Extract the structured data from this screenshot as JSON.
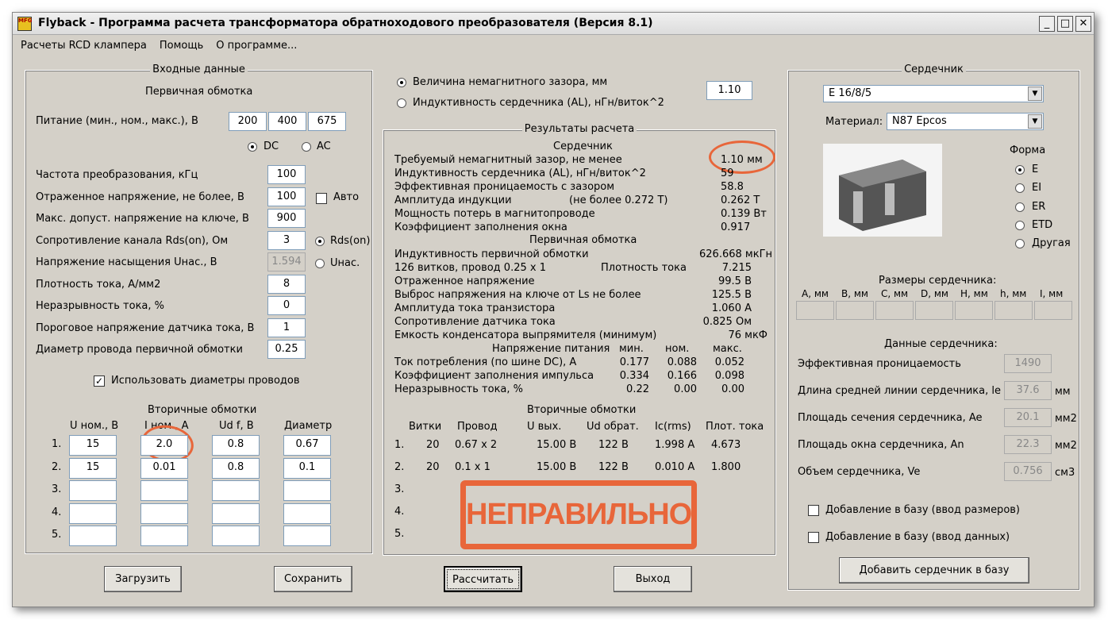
{
  "window": {
    "title": "Flyback - Программа расчета трансформатора обратноходового преобразователя (Версия 8.1)",
    "app_icon_text": "MFG"
  },
  "menu": [
    "Расчеты RCD клампера",
    "Помощь",
    "О программе..."
  ],
  "input": {
    "group": "Входные данные",
    "primary": "Первичная обмотка",
    "supply_label": "Питание (мин., ном., макс.), В",
    "supply": [
      "200",
      "400",
      "675"
    ],
    "dc": "DC",
    "ac": "AC",
    "dc_selected": true,
    "rows": [
      {
        "label": "Частота преобразования, кГц",
        "value": "100"
      },
      {
        "label": "Отраженное напряжение, не более, В",
        "value": "100"
      },
      {
        "label": "Макс. допуст. напряжение на ключе, В",
        "value": "900"
      },
      {
        "label": "Сопротивление канала Rds(on), Ом",
        "value": "3"
      },
      {
        "label": "Напряжение насыщения Uнас., В",
        "value": "1.594"
      },
      {
        "label": "Плотность тока, А/мм2",
        "value": "8"
      },
      {
        "label": "Неразрывность тока, %",
        "value": "0"
      },
      {
        "label": "Пороговое напряжение датчика тока, В",
        "value": "1"
      },
      {
        "label": "Диаметр провода первичной обмотки",
        "value": "0.25"
      }
    ],
    "auto": "Авто",
    "auto_checked": false,
    "rds": "Rds(on)",
    "usat": "Uнас.",
    "rds_selected": true,
    "use_diam": "Использовать диаметры проводов",
    "use_diam_checked": true,
    "secondary": "Вторичные обмотки",
    "sec_headers": [
      "U ном., В",
      "I ном., А",
      "Ud f, В",
      "Диаметр"
    ],
    "sec_rows": [
      {
        "n": "1.",
        "v": [
          "15",
          "2.0",
          "0.8",
          "0.67"
        ]
      },
      {
        "n": "2.",
        "v": [
          "15",
          "0.01",
          "0.8",
          "0.1"
        ]
      },
      {
        "n": "3.",
        "v": [
          "",
          "",
          "",
          ""
        ]
      },
      {
        "n": "4.",
        "v": [
          "",
          "",
          "",
          ""
        ]
      },
      {
        "n": "5.",
        "v": [
          "",
          "",
          "",
          ""
        ]
      }
    ]
  },
  "gap": {
    "opt1": "Величина немагнитного зазора, мм",
    "opt2": "Индуктивность сердечника (AL), нГн/виток^2",
    "value": "1.10",
    "opt1_selected": true
  },
  "results": {
    "group": "Результаты расчета",
    "core": "Сердечник",
    "core_rows": [
      [
        "Требуемый немагнитный зазор, не менее",
        "",
        "1.10 мм"
      ],
      [
        "Индуктивность сердечника (AL), нГн/виток^2",
        "",
        "59"
      ],
      [
        "Эффективная проницаемость с зазором",
        "",
        "58.8"
      ],
      [
        "Амплитуда индукции",
        "(не более 0.272 Т)",
        "0.262 Т"
      ],
      [
        "Мощность потерь в магнитопроводе",
        "",
        "0.139 Вт"
      ],
      [
        "Коэффициент заполнения окна",
        "",
        "0.917"
      ]
    ],
    "primary": "Первичная обмотка",
    "prim_rows": [
      [
        "Индуктивность первичной обмотки",
        "",
        "626.668 мкГн"
      ],
      [
        "126  витков, провод 0.25 x 1",
        "Плотность тока",
        "7.215"
      ],
      [
        "Отраженное напряжение",
        "",
        "99.5 В"
      ],
      [
        "Выброс напряжения на ключе от Ls не более",
        "",
        "125.5 В"
      ],
      [
        "Амплитуда тока транзистора",
        "",
        "1.060 А"
      ],
      [
        "Сопротивление датчика тока",
        "",
        "0.825 Ом"
      ],
      [
        "Емкость конденсатора выпрямителя (минимум)",
        "",
        "76 мкФ"
      ]
    ],
    "supply_hdr": [
      "Напряжение питания",
      "мин.",
      "ном.",
      "макс."
    ],
    "supply_rows": [
      [
        "Ток потребления (по шине DC), А",
        "0.177",
        "0.088",
        "0.052"
      ],
      [
        "Коэффициент заполнения импульса",
        "0.334",
        "0.166",
        "0.098"
      ],
      [
        "Неразрывность тока, %",
        "0.22",
        "0.00",
        "0.00"
      ]
    ],
    "secondary": "Вторичные обмотки",
    "sec_headers": [
      "Витки",
      "Провод",
      "U вых.",
      "Ud обрат.",
      "Ic(rms)",
      "Плот. тока"
    ],
    "sec_rows": [
      [
        "1.",
        "20",
        "0.67 x 2",
        "15.00 В",
        "122 В",
        "1.998 А",
        "4.673"
      ],
      [
        "2.",
        "20",
        "0.1 x 1",
        "15.00 В",
        "122 В",
        "0.010 А",
        "1.800"
      ],
      [
        "3."
      ],
      [
        "4."
      ],
      [
        "5."
      ]
    ],
    "stamp": "НЕПРАВИЛЬНО"
  },
  "core": {
    "group": "Сердечник",
    "type": "E 16/8/5",
    "material_label": "Материал:",
    "material": "N87 Epcos",
    "shape_label": "Форма",
    "shapes": [
      "E",
      "EI",
      "ER",
      "ETD",
      "Другая"
    ],
    "shape_selected": "E",
    "dims_label": "Размеры сердечника:",
    "dims": [
      "A, мм",
      "B, мм",
      "C, мм",
      "D, мм",
      "H, мм",
      "h, мм",
      "I, мм"
    ],
    "data_label": "Данные сердечника:",
    "data": [
      {
        "label": "Эффективная проницаемость",
        "value": "1490",
        "unit": ""
      },
      {
        "label": "Длина средней линии сердечника, le",
        "value": "37.6",
        "unit": "мм"
      },
      {
        "label": "Площадь сечения сердечника, Ae",
        "value": "20.1",
        "unit": "мм2"
      },
      {
        "label": "Площадь окна сердечника, An",
        "value": "22.3",
        "unit": "мм2"
      },
      {
        "label": "Объем сердечника, Ve",
        "value": "0.756",
        "unit": "см3"
      }
    ],
    "add_dims": "Добавление в базу (ввод размеров)",
    "add_data": "Добавление в базу (ввод данных)",
    "add_btn": "Добавить сердечник в базу"
  },
  "buttons": {
    "load": "Загрузить",
    "save": "Сохранить",
    "calc": "Рассчитать",
    "exit": "Выход"
  },
  "colors": {
    "annotation": "#e8663a",
    "face": "#d4d0c8"
  }
}
